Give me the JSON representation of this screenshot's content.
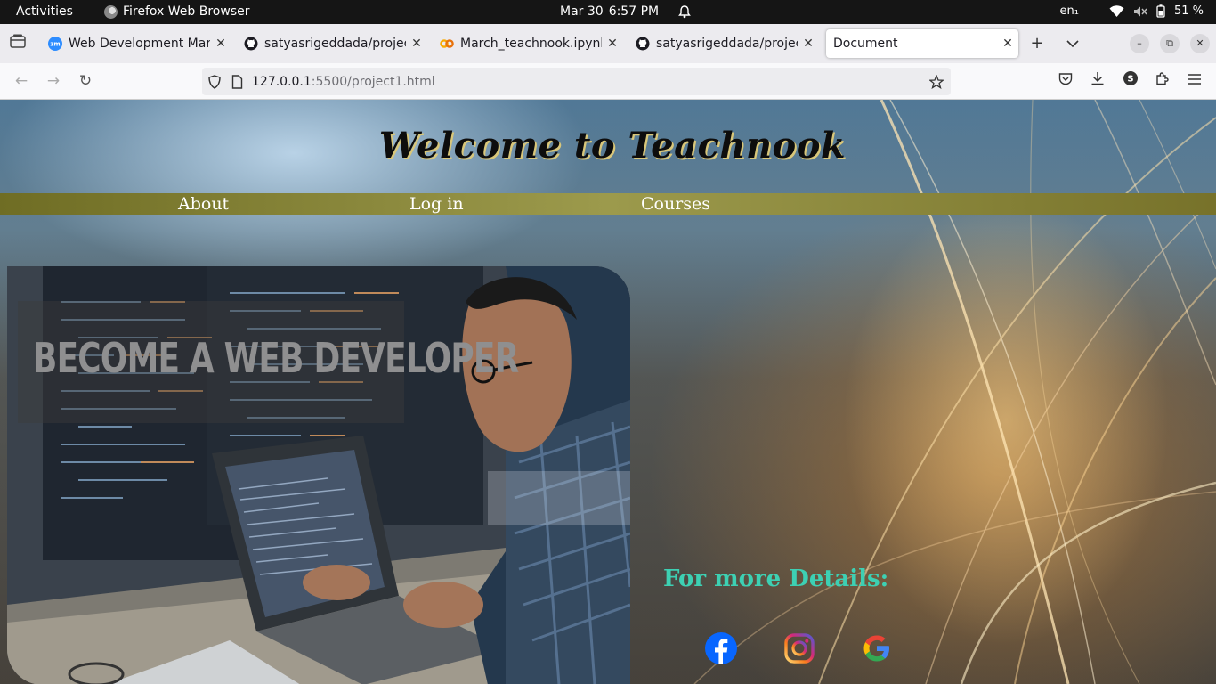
{
  "topbar": {
    "activities": "Activities",
    "app_name": "Firefox Web Browser",
    "date": "Mar 30",
    "time": "6:57 PM",
    "lang": "en₁",
    "battery": "51 %"
  },
  "tabs": [
    {
      "title": "Web Development March",
      "icon": "zoom-icon"
    },
    {
      "title": "satyasrigeddada/project",
      "icon": "github-icon"
    },
    {
      "title": "March_teachnook.ipynb",
      "icon": "colab-icon"
    },
    {
      "title": "satyasrigeddada/project",
      "icon": "github-icon"
    },
    {
      "title": "Document",
      "icon": "none",
      "active": true
    }
  ],
  "address": {
    "host": "127.0.0.1",
    "rest": ":5500/project1.html"
  },
  "page": {
    "title": "Welcome to Teachnook",
    "menu": [
      "About",
      "Log in",
      "Courses"
    ],
    "hero_text": "BECOME A WEB DEVELOPER",
    "details_label": "For more Details:",
    "social": [
      "facebook-icon",
      "instagram-icon",
      "google-icon"
    ]
  }
}
